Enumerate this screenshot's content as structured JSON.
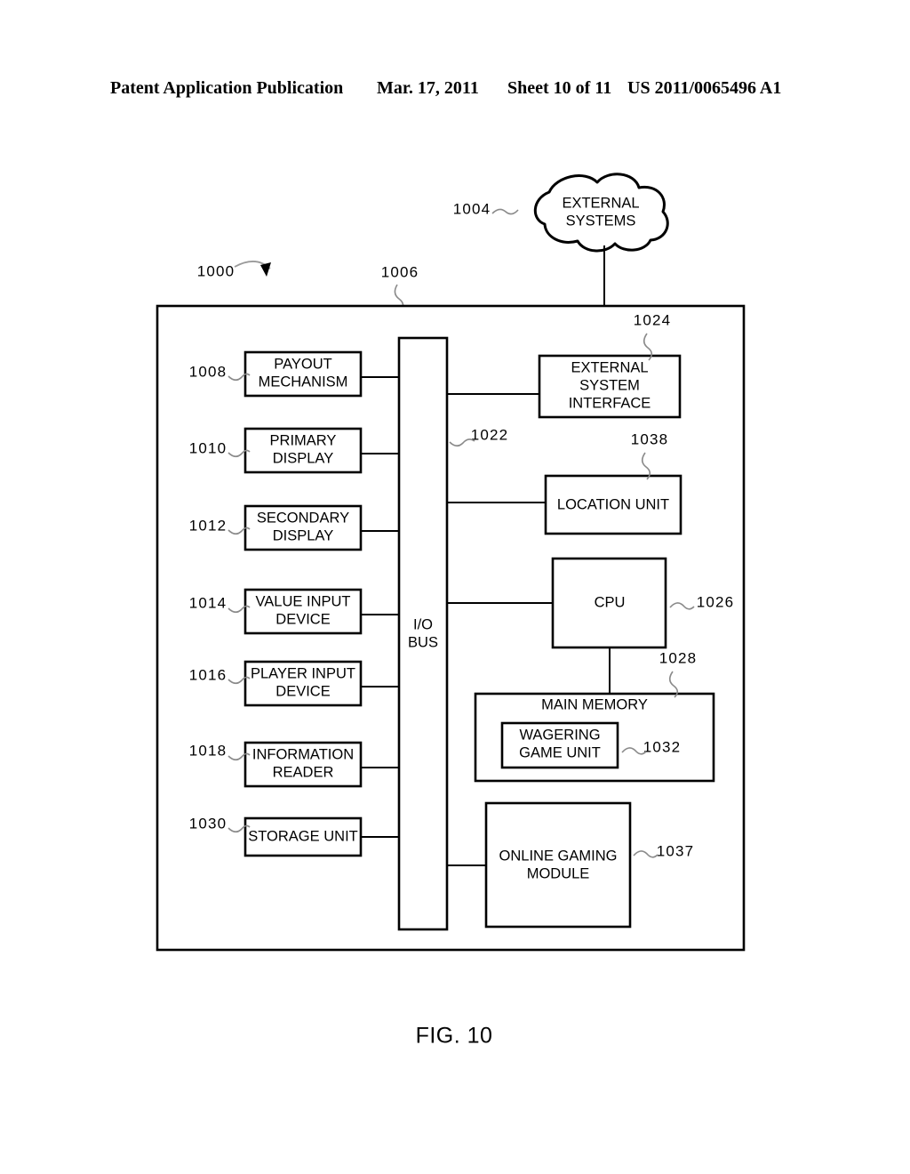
{
  "header": {
    "publication": "Patent Application Publication",
    "date": "Mar. 17, 2011",
    "sheet": "Sheet 10 of 11",
    "patent_number": "US 2011/0065496 A1"
  },
  "figure": {
    "caption": "FIG. 10",
    "system_ref": "1000",
    "enclosure_ref": "1006"
  },
  "cloud": {
    "label_line1": "EXTERNAL",
    "label_line2": "SYSTEMS",
    "ref": "1004"
  },
  "bus": {
    "label_line1": "I/O",
    "label_line2": "BUS",
    "ref": "1022"
  },
  "left_blocks": [
    {
      "ref": "1008",
      "line1": "PAYOUT",
      "line2": "MECHANISM"
    },
    {
      "ref": "1010",
      "line1": "PRIMARY",
      "line2": "DISPLAY"
    },
    {
      "ref": "1012",
      "line1": "SECONDARY",
      "line2": "DISPLAY"
    },
    {
      "ref": "1014",
      "line1": "VALUE INPUT",
      "line2": "DEVICE"
    },
    {
      "ref": "1016",
      "line1": "PLAYER INPUT",
      "line2": "DEVICE"
    },
    {
      "ref": "1018",
      "line1": "INFORMATION",
      "line2": "READER"
    },
    {
      "ref": "1030",
      "line1": "STORAGE UNIT",
      "line2": ""
    }
  ],
  "right_blocks": [
    {
      "ref": "1024",
      "line1": "EXTERNAL",
      "line2": "SYSTEM",
      "line3": "INTERFACE"
    },
    {
      "ref": "1038",
      "line1": "LOCATION UNIT",
      "line2": "",
      "line3": ""
    },
    {
      "ref": "1026",
      "line1": "CPU",
      "line2": "",
      "line3": ""
    },
    {
      "ref": "1037",
      "line1": "ONLINE GAMING",
      "line2": "MODULE",
      "line3": ""
    }
  ],
  "memory": {
    "ref": "1028",
    "title": "MAIN MEMORY",
    "inner": {
      "ref": "1032",
      "line1": "WAGERING",
      "line2": "GAME UNIT"
    }
  },
  "colors": {
    "ink": "#000000",
    "leader": "#8a8a8a",
    "paper": "#ffffff"
  }
}
